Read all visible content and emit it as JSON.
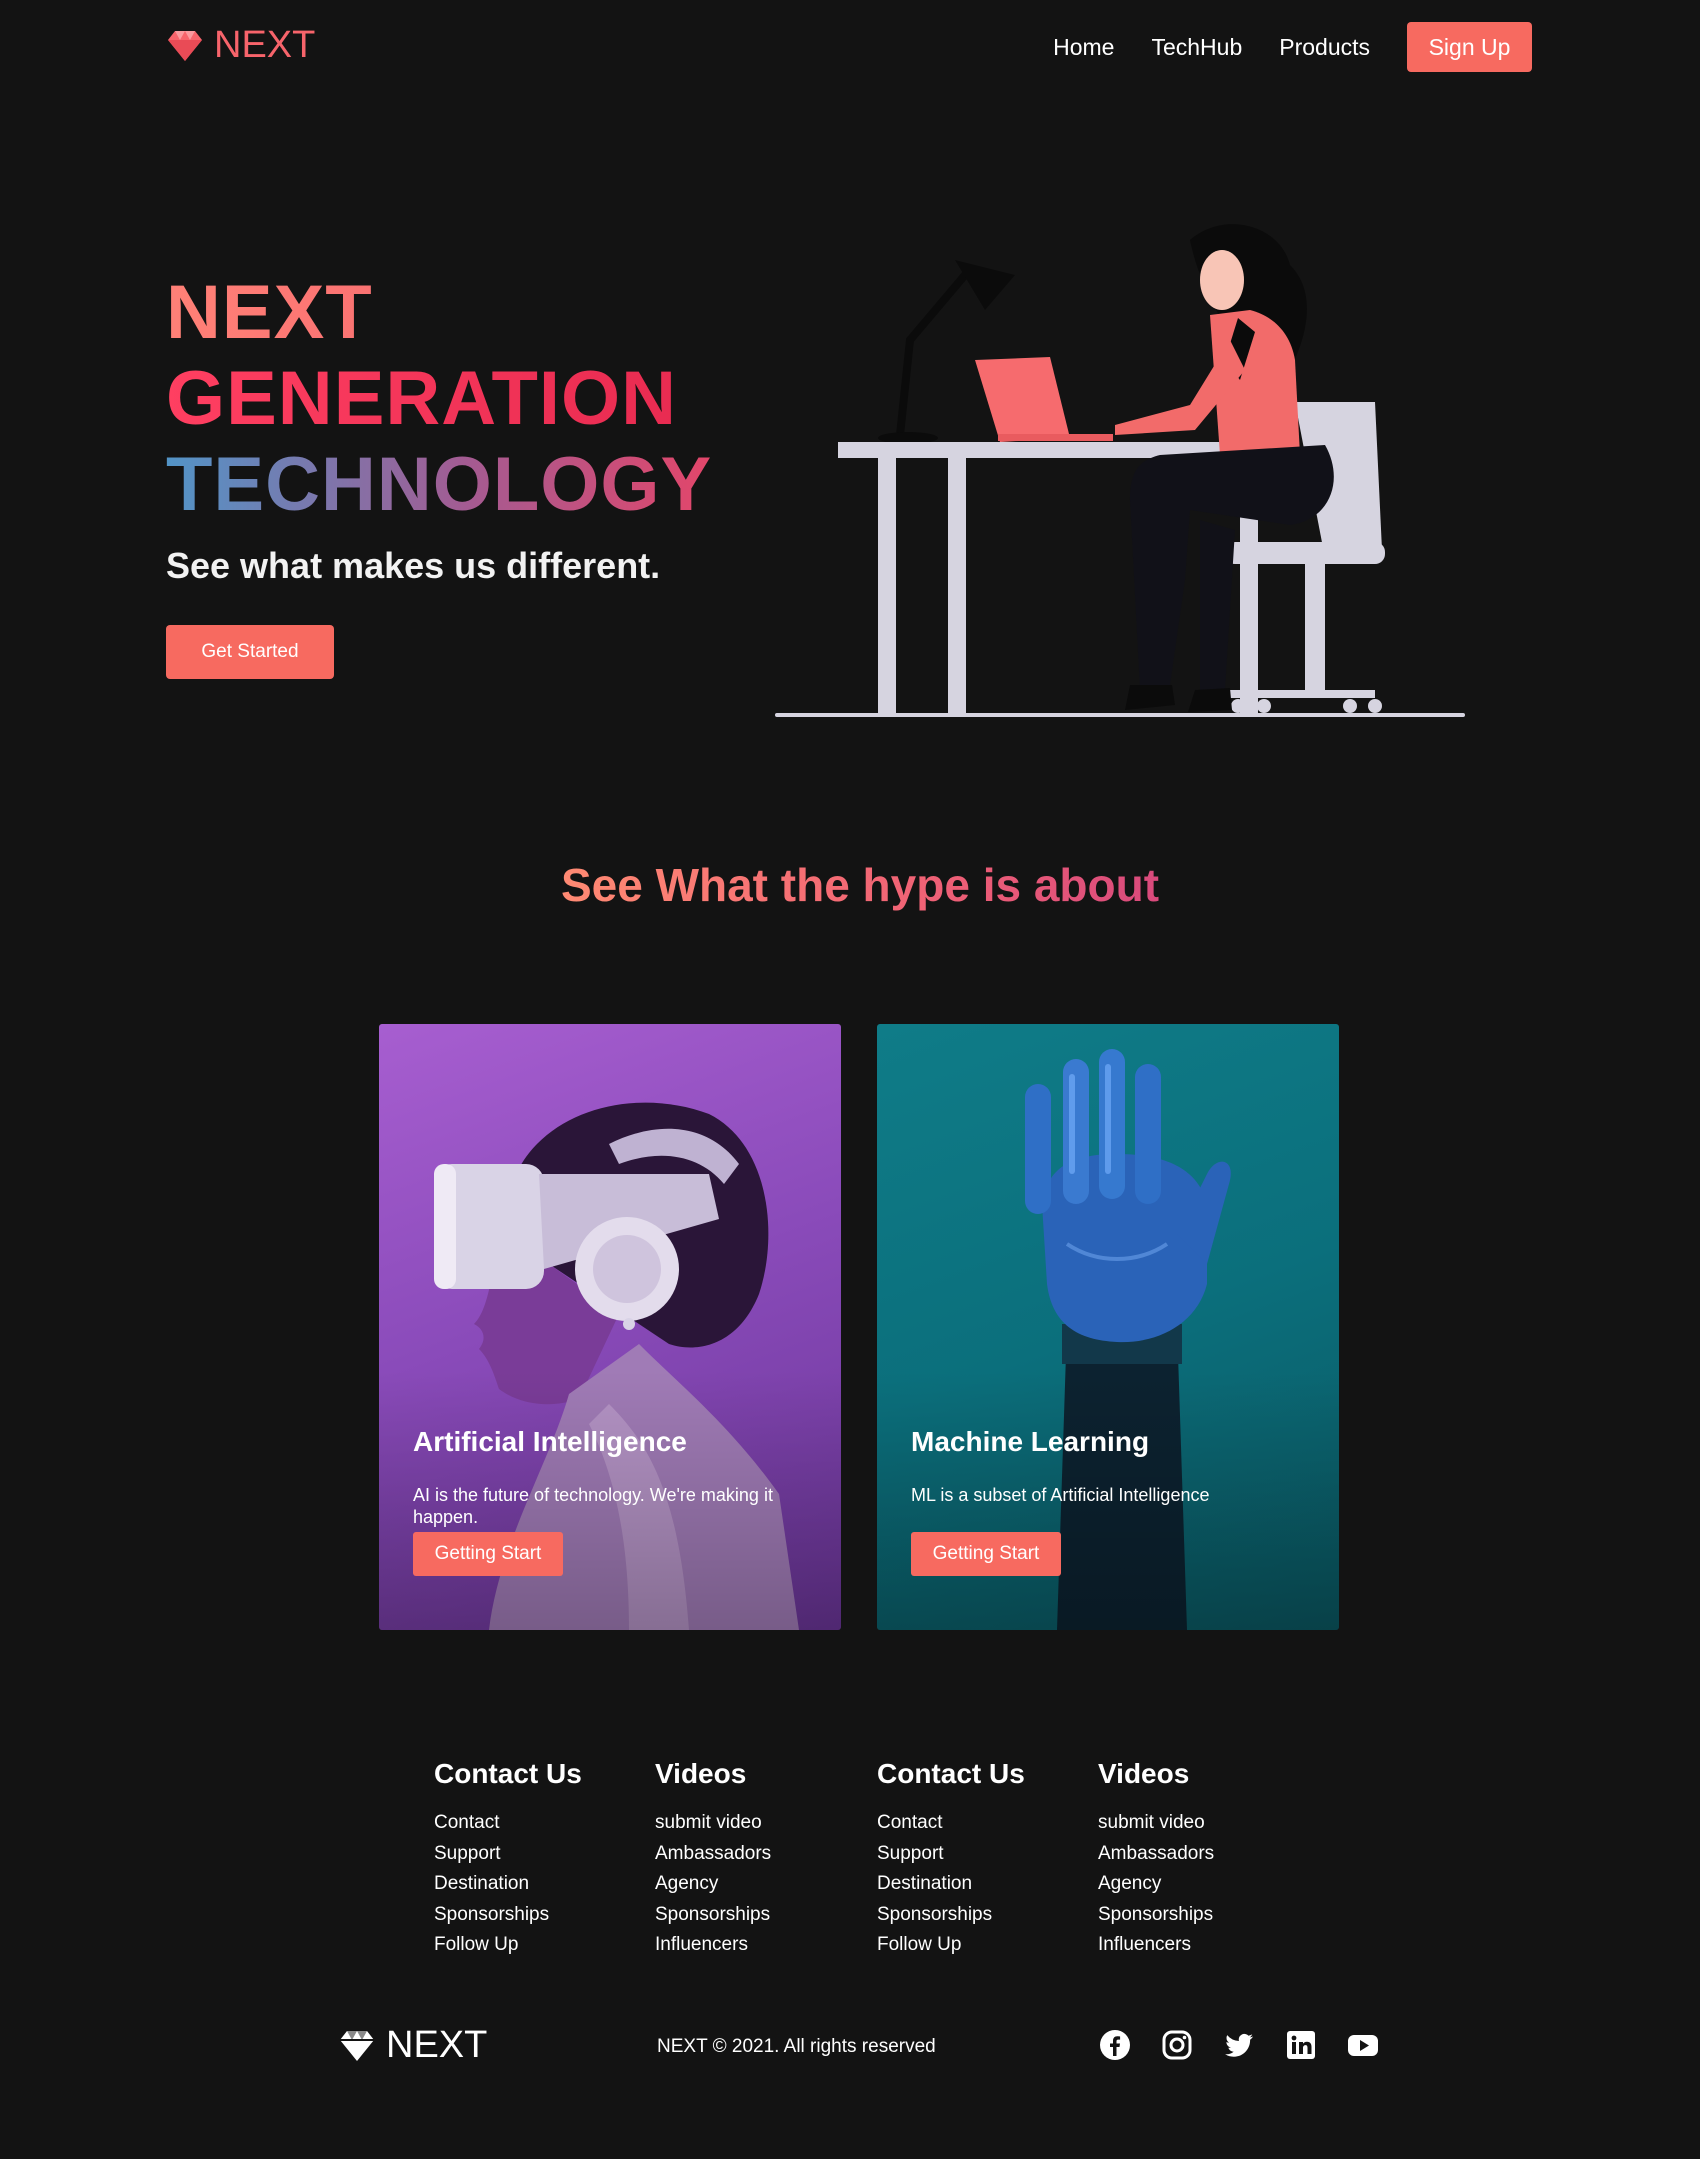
{
  "brand": {
    "name": "NEXT",
    "accent": "#f76a60"
  },
  "nav": {
    "links": [
      "Home",
      "TechHub",
      "Products"
    ],
    "signup_label": "Sign Up"
  },
  "hero": {
    "line1": "NEXT",
    "line2": "GENERATION",
    "line3": "TECHNOLOGY",
    "subtitle": "See what makes us different.",
    "cta_label": "Get Started"
  },
  "section": {
    "title": "See What the hype is about"
  },
  "cards": [
    {
      "title": "Artificial Intelligence",
      "description": "AI is the future of technology. We're making it happen.",
      "button_label": "Getting Start"
    },
    {
      "title": "Machine Learning",
      "description": "ML is a subset of Artificial Intelligence",
      "button_label": "Getting Start"
    }
  ],
  "footer": {
    "columns": [
      {
        "heading": "Contact Us",
        "items": [
          "Contact",
          "Support",
          "Destination",
          "Sponsorships",
          "Follow Up"
        ]
      },
      {
        "heading": "Videos",
        "items": [
          "submit video",
          "Ambassadors",
          "Agency",
          "Sponsorships",
          "Influencers"
        ]
      },
      {
        "heading": "Contact Us",
        "items": [
          "Contact",
          "Support",
          "Destination",
          "Sponsorships",
          "Follow Up"
        ]
      },
      {
        "heading": "Videos",
        "items": [
          "submit video",
          "Ambassadors",
          "Agency",
          "Sponsorships",
          "Influencers"
        ]
      }
    ],
    "copyright": "NEXT © 2021. All rights reserved",
    "social_icons": [
      "facebook-icon",
      "instagram-icon",
      "twitter-icon",
      "linkedin-icon",
      "youtube-icon"
    ]
  }
}
